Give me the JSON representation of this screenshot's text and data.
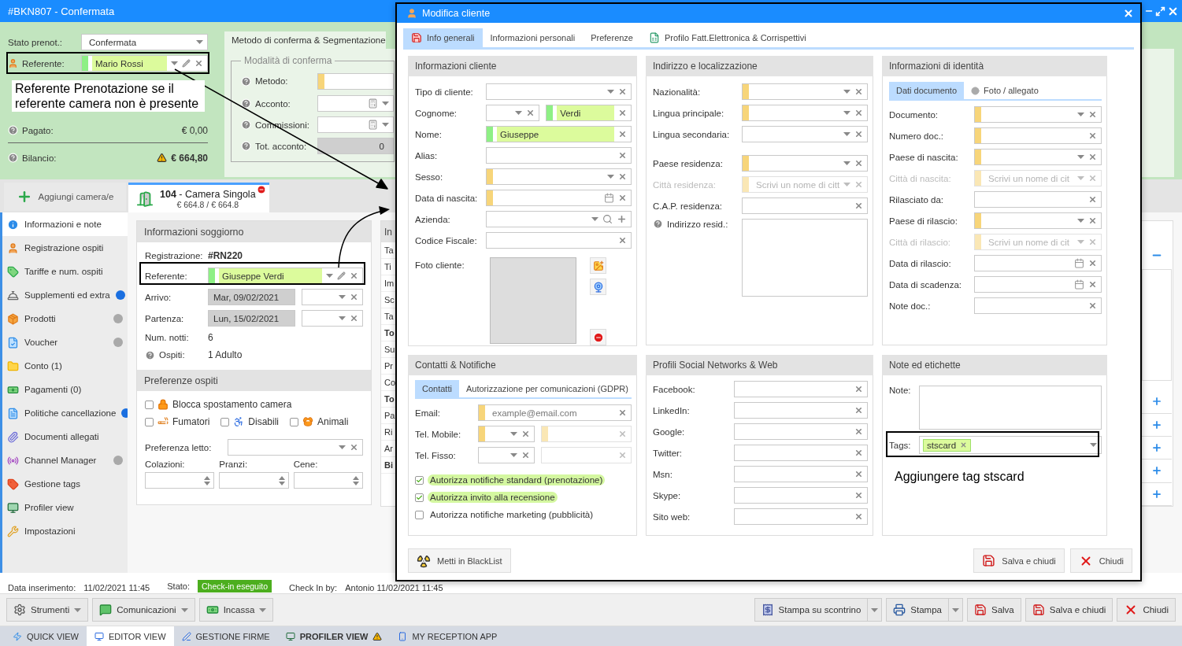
{
  "window": {
    "title": "#BKN807 - Confermata"
  },
  "booking": {
    "fields": [
      {
        "label": "Stato prenot.:",
        "inputs": [
          {
            "kind": "dropdown",
            "value": "Confermata"
          }
        ]
      },
      {
        "label": "Referente:",
        "inputs": [
          {
            "kind": "person",
            "value": "Mario Rossi",
            "valid": true
          }
        ]
      },
      {
        "label": "Pagato:",
        "help": true,
        "inputs": [
          {
            "kind": "info",
            "value": "€ 0,00"
          }
        ]
      },
      {
        "label": "Bilancio:",
        "help": true,
        "inputs": [
          {
            "kind": "alert",
            "value": "€ 664,80"
          }
        ]
      }
    ]
  },
  "confirmation": {
    "tab": "Metodo di conferma & Segmentazione",
    "legend": "Modalità di conferma",
    "fields": [
      {
        "label": "Metodo:",
        "help": true,
        "inputs": [
          {
            "kind": "blank",
            "required": true
          }
        ]
      },
      {
        "label": "Acconto:",
        "help": true,
        "inputs": [
          {
            "kind": "calc"
          }
        ]
      },
      {
        "label": "Commissioni:",
        "help": true,
        "inputs": [
          {
            "kind": "calc"
          }
        ]
      },
      {
        "label": "Tot. acconto:",
        "help": true,
        "inputs": [
          {
            "kind": "total",
            "value": "0"
          }
        ]
      }
    ]
  },
  "rooms": {
    "add_label": "Aggiungi camera/e",
    "tabs": [
      {
        "title": "**104** - Camera Singola",
        "price": "€ 664.8 / € 664.8",
        "selected": true
      }
    ]
  },
  "sidebar": {
    "items": [
      {
        "label": "Informazioni e note",
        "selected": true
      },
      {
        "label": "Registrazione ospiti",
        "selected": false
      },
      {
        "label": "Tariffe e num. ospiti",
        "selected": false
      },
      {
        "label": "Supplementi ed extra",
        "selected": false,
        "color": "#1a6fe0"
      },
      {
        "label": "Prodotti",
        "selected": false,
        "color": "#a9a9a9"
      },
      {
        "label": "Voucher",
        "selected": false,
        "color": "#a9a9a9"
      },
      {
        "label": "Conto (1)",
        "selected": false
      },
      {
        "label": "Pagamenti (0)",
        "selected": false
      },
      {
        "label": "Politiche cancellazione",
        "selected": false,
        "color": "#1a6fe0"
      },
      {
        "label": "Documenti allegati",
        "selected": false
      },
      {
        "label": "Channel Manager",
        "selected": false,
        "color": "#a9a9a9"
      },
      {
        "label": "Gestione tags",
        "selected": false
      },
      {
        "label": "Profiler view",
        "selected": false
      },
      {
        "label": "Impostazioni",
        "selected": false
      }
    ]
  },
  "stay": {
    "title": "Informazioni soggiorno",
    "fields": [
      {
        "label": "Registrazione:",
        "inputs": [
          {
            "kind": "strong",
            "value": "#RN220"
          }
        ]
      },
      {
        "label": "Referente:",
        "inputs": [
          {
            "kind": "person",
            "value": "Giuseppe Verdi",
            "valid": true
          }
        ]
      },
      {
        "label": "Arrivo:",
        "inputs": [
          {
            "kind": "readonly",
            "value": "Mar, 09/02/2021"
          },
          {
            "kind": "select"
          }
        ]
      },
      {
        "label": "Partenza:",
        "inputs": [
          {
            "kind": "readonly",
            "value": "Lun, 15/02/2021"
          },
          {
            "kind": "select"
          }
        ]
      },
      {
        "label": "Num. notti:",
        "inputs": [
          {
            "kind": "info",
            "value": "6"
          }
        ]
      },
      {
        "label": "Ospiti:",
        "help": true,
        "inputs": [
          {
            "kind": "info",
            "value": "1 Adulto"
          }
        ]
      }
    ],
    "preferences_title": "Preferenze ospiti",
    "options": [
      {
        "label": "Blocca spostamento camera",
        "checked": false
      },
      {
        "label": "Fumatori",
        "checked": false
      },
      {
        "label": "Disabili",
        "checked": false
      },
      {
        "label": "Animali",
        "checked": false
      }
    ],
    "bed": {
      "label": "Preferenza letto:",
      "inputs": [
        {
          "kind": "select"
        }
      ]
    },
    "meals": [
      {
        "label": "Colazioni:"
      },
      {
        "label": "Pranzi:"
      },
      {
        "label": "Cene:"
      }
    ]
  },
  "summary": {
    "title": "In",
    "rows": [
      {
        "label": "Ta",
        "kind": "item"
      },
      {
        "label": "Ti",
        "kind": "item"
      },
      {
        "label": "Im",
        "kind": "item"
      },
      {
        "label": "Sc",
        "kind": "item"
      },
      {
        "label": "Ta",
        "kind": "item"
      },
      {
        "label": "To",
        "kind": "total"
      },
      {
        "label": "Su",
        "kind": "item"
      },
      {
        "label": "Pr",
        "kind": "item"
      },
      {
        "label": "Co",
        "kind": "item"
      },
      {
        "label": "To",
        "kind": "total"
      },
      {
        "label": "Pa",
        "kind": "item"
      },
      {
        "label": "Ri",
        "kind": "item"
      },
      {
        "label": "Ar",
        "kind": "item"
      },
      {
        "label": "Bi",
        "kind": "total"
      }
    ]
  },
  "side_actions": [
    {
      "kind": "collapse"
    },
    {
      "kind": "add"
    },
    {
      "kind": "add"
    },
    {
      "kind": "add"
    },
    {
      "kind": "add"
    },
    {
      "kind": "add"
    }
  ],
  "status": {
    "items": [
      {
        "label": "Data inserimento:",
        "value": "11/02/2021 11:45"
      },
      {
        "label": "Stato:",
        "badge": "Check-in eseguito"
      },
      {
        "label": "Check In by:",
        "value": "Antonio 11/02/2021 11:45"
      }
    ]
  },
  "toolbar": {
    "left": [
      {
        "label": "Strumenti",
        "kind": "menu"
      },
      {
        "label": "Comunicazioni",
        "kind": "menu"
      },
      {
        "label": "Incassa",
        "kind": "menu"
      }
    ],
    "right": [
      {
        "label": "Stampa su scontrino",
        "kind": "split"
      },
      {
        "label": "Stampa",
        "kind": "split"
      },
      {
        "label": "Salva",
        "kind": "plain"
      },
      {
        "label": "Salva e chiudi",
        "kind": "plain"
      },
      {
        "label": "Chiudi",
        "kind": "plain"
      }
    ]
  },
  "views": [
    {
      "label": "QUICK VIEW",
      "selected": false,
      "kind": "plain"
    },
    {
      "label": "EDITOR VIEW",
      "selected": true,
      "kind": "plain"
    },
    {
      "label": "GESTIONE FIRME",
      "selected": false,
      "kind": "plain"
    },
    {
      "label": "PROFILER VIEW",
      "selected": false,
      "kind": "alert"
    },
    {
      "label": "MY RECEPTION APP",
      "selected": false,
      "kind": "plain"
    }
  ],
  "dialog": {
    "title": "Modifica cliente",
    "tabs": [
      {
        "label": "Info generali",
        "selected": true
      },
      {
        "label": "Informazioni personali",
        "selected": false
      },
      {
        "label": "Preferenze",
        "selected": false
      },
      {
        "label": "Profilo Fatt.Elettronica & Corrispettivi",
        "selected": false
      }
    ],
    "client": {
      "title": "Informazioni cliente",
      "photo_label": "Foto cliente:",
      "fields": [
        {
          "label": "Tipo di cliente:",
          "inputs": [
            {
              "kind": "select"
            }
          ]
        },
        {
          "label": "Cognome:",
          "inputs": [
            {
              "kind": "select"
            },
            {
              "kind": "text",
              "value": "Verdi",
              "valid": true
            }
          ]
        },
        {
          "label": "Nome:",
          "inputs": [
            {
              "kind": "text",
              "value": "Giuseppe",
              "valid": true
            }
          ]
        },
        {
          "label": "Alias:",
          "inputs": [
            {
              "kind": "text"
            }
          ]
        },
        {
          "label": "Sesso:",
          "inputs": [
            {
              "kind": "select",
              "required": true
            }
          ]
        },
        {
          "label": "Data di nascita:",
          "inputs": [
            {
              "kind": "date",
              "required": true
            }
          ]
        },
        {
          "label": "Azienda:",
          "inputs": [
            {
              "kind": "lookup"
            }
          ]
        },
        {
          "label": "Codice Fiscale:",
          "inputs": [
            {
              "kind": "text"
            }
          ]
        }
      ]
    },
    "address": {
      "title": "Indirizzo e localizzazione",
      "fields": [
        {
          "label": "Nazionalità:",
          "inputs": [
            {
              "kind": "select",
              "required": true
            }
          ]
        },
        {
          "label": "Lingua principale:",
          "inputs": [
            {
              "kind": "select",
              "required": true
            }
          ]
        },
        {
          "label": "Lingua secondaria:",
          "inputs": [
            {
              "kind": "select"
            }
          ]
        },
        {
          "label": "Paese residenza:",
          "inputs": [
            {
              "kind": "select",
              "required": true
            }
          ]
        },
        {
          "label": "Città residenza:",
          "inputs": [
            {
              "kind": "select",
              "required": true,
              "disabled": true,
              "placeholder": "Scrivi un nome di citt"
            }
          ]
        },
        {
          "label": "C.A.P. residenza:",
          "inputs": [
            {
              "kind": "text"
            }
          ]
        },
        {
          "label": "Indirizzo resid.:",
          "help": true,
          "inputs": [
            {
              "kind": "area"
            }
          ]
        }
      ]
    },
    "identity": {
      "title": "Informazioni di identità",
      "tabs": [
        {
          "label": "Dati documento",
          "selected": true
        },
        {
          "label": "Foto / allegato",
          "selected": false
        }
      ],
      "fields": [
        {
          "label": "Documento:",
          "inputs": [
            {
              "kind": "select",
              "required": true
            }
          ]
        },
        {
          "label": "Numero doc.:",
          "inputs": [
            {
              "kind": "text",
              "required": true
            }
          ]
        },
        {
          "label": "Paese di nascita:",
          "inputs": [
            {
              "kind": "select",
              "required": true
            }
          ]
        },
        {
          "label": "Città di nascita:",
          "inputs": [
            {
              "kind": "select",
              "required": true,
              "disabled": true,
              "placeholder": "Scrivi un nome di cit"
            }
          ]
        },
        {
          "label": "Rilasciato da:",
          "inputs": [
            {
              "kind": "text"
            }
          ]
        },
        {
          "label": "Paese di rilascio:",
          "inputs": [
            {
              "kind": "select",
              "required": true
            }
          ]
        },
        {
          "label": "Città di rilascio:",
          "inputs": [
            {
              "kind": "select",
              "required": true,
              "disabled": true,
              "placeholder": "Scrivi un nome di cit"
            }
          ]
        },
        {
          "label": "Data di rilascio:",
          "inputs": [
            {
              "kind": "date"
            }
          ]
        },
        {
          "label": "Data di scadenza:",
          "inputs": [
            {
              "kind": "date"
            }
          ]
        },
        {
          "label": "Note doc.:",
          "inputs": [
            {
              "kind": "text"
            }
          ]
        }
      ]
    },
    "contacts": {
      "title": "Contatti & Notifiche",
      "tabs": [
        {
          "label": "Contatti",
          "selected": true
        },
        {
          "label": "Autorizzazione per comunicazioni (GDPR)",
          "selected": false
        }
      ],
      "fields": [
        {
          "label": "Email:",
          "inputs": [
            {
              "kind": "text",
              "required": true,
              "placeholder": "example@email.com"
            }
          ]
        },
        {
          "label": "Tel. Mobile:",
          "inputs": [
            {
              "kind": "select",
              "required": true
            },
            {
              "kind": "text",
              "required": true,
              "disabled": true
            }
          ]
        },
        {
          "label": "Tel. Fisso:",
          "inputs": [
            {
              "kind": "select"
            },
            {
              "kind": "text",
              "disabled": true
            }
          ]
        }
      ],
      "consents": [
        {
          "label": "Autorizza notifiche standard (prenotazione)",
          "checked": true
        },
        {
          "label": "Autorizza invito alla recensione",
          "checked": true
        },
        {
          "label": "Autorizza notifiche marketing (pubblicità)",
          "checked": false
        }
      ]
    },
    "social": {
      "title": "Profili Social Networks & Web",
      "fields": [
        {
          "label": "Facebook:",
          "inputs": [
            {
              "kind": "text"
            }
          ]
        },
        {
          "label": "LinkedIn:",
          "inputs": [
            {
              "kind": "text"
            }
          ]
        },
        {
          "label": "Google:",
          "inputs": [
            {
              "kind": "text"
            }
          ]
        },
        {
          "label": "Twitter:",
          "inputs": [
            {
              "kind": "text"
            }
          ]
        },
        {
          "label": "Msn:",
          "inputs": [
            {
              "kind": "text"
            }
          ]
        },
        {
          "label": "Skype:",
          "inputs": [
            {
              "kind": "text"
            }
          ]
        },
        {
          "label": "Sito web:",
          "inputs": [
            {
              "kind": "text"
            }
          ]
        }
      ]
    },
    "notes": {
      "title": "Note ed etichette",
      "note_label": "Note:",
      "tags_label": "Tags:",
      "tags": [
        "stscard"
      ]
    },
    "buttons": [
      {
        "label": "Metti in BlackList",
        "kind": "blacklist"
      },
      {
        "label": "Salva e chiudi",
        "kind": "save"
      },
      {
        "label": "Chiudi",
        "kind": "close"
      }
    ]
  },
  "annotations": [
    {
      "text": "Referente Prenotazione se il referente camera non è presente"
    },
    {
      "text": "Aggiungere tag stscard"
    }
  ]
}
